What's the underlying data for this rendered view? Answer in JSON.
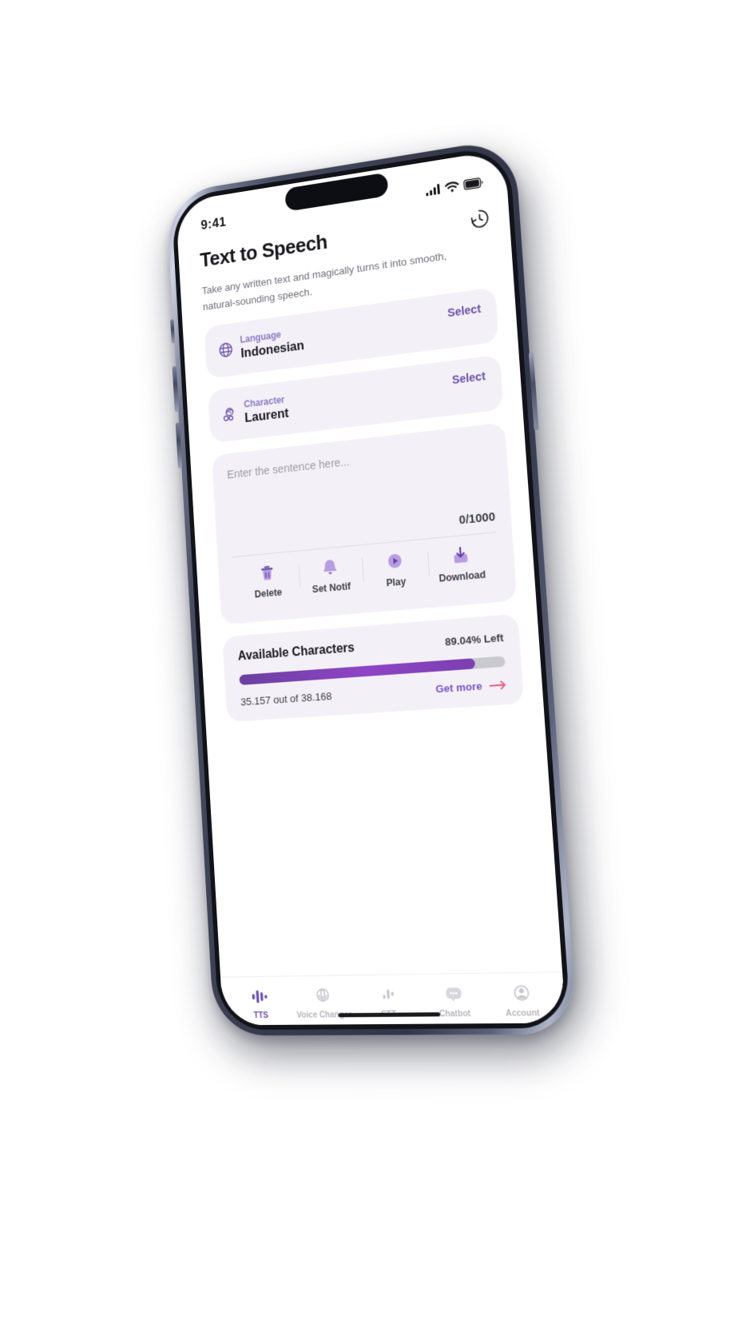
{
  "device": {
    "status_bar": {
      "time": "9:41",
      "icons": [
        "cellular-signal-icon",
        "wifi-icon",
        "battery-icon"
      ]
    }
  },
  "header": {
    "title": "Text to Speech",
    "description": "Take any written text and magically turns it into smooth, natural-sounding speech.",
    "history_icon": "history-clock-icon"
  },
  "selectors": [
    {
      "label": "Language",
      "value": "Indonesian",
      "action": "Select",
      "icon": "globe-icon"
    },
    {
      "label": "Character",
      "value": "Laurent",
      "action": "Select",
      "icon": "character-avatar-icon"
    }
  ],
  "editor": {
    "placeholder": "Enter the sentence here...",
    "value": "",
    "counter": "0/1000",
    "actions": [
      {
        "label": "Delete",
        "icon": "trash-icon"
      },
      {
        "label": "Set Notif",
        "icon": "bell-icon"
      },
      {
        "label": "Play",
        "icon": "play-circle-icon"
      },
      {
        "label": "Download",
        "icon": "download-icon"
      }
    ]
  },
  "quota": {
    "title": "Available Characters",
    "percent_left": "89.04% Left",
    "progress_percent": 89.04,
    "count": "35.157 out of 38.168",
    "get_more": "Get more",
    "arrow_icon": "arrow-right-icon"
  },
  "tabbar": {
    "items": [
      {
        "label": "TTS",
        "icon": "waveform-icon",
        "active": true
      },
      {
        "label": "Voice Changer",
        "icon": "voice-changer-icon",
        "active": false
      },
      {
        "label": "STT",
        "icon": "speech-to-text-icon",
        "active": false
      },
      {
        "label": "Chatbot",
        "icon": "chat-bubble-icon",
        "active": false
      },
      {
        "label": "Account",
        "icon": "user-circle-icon",
        "active": false
      }
    ]
  },
  "colors": {
    "accent": "#6b4fa8",
    "accent_light": "#8a79c4",
    "progress": "#7b3fb0",
    "card_bg": "#f3f1f7",
    "arrow": "#e8607f"
  }
}
